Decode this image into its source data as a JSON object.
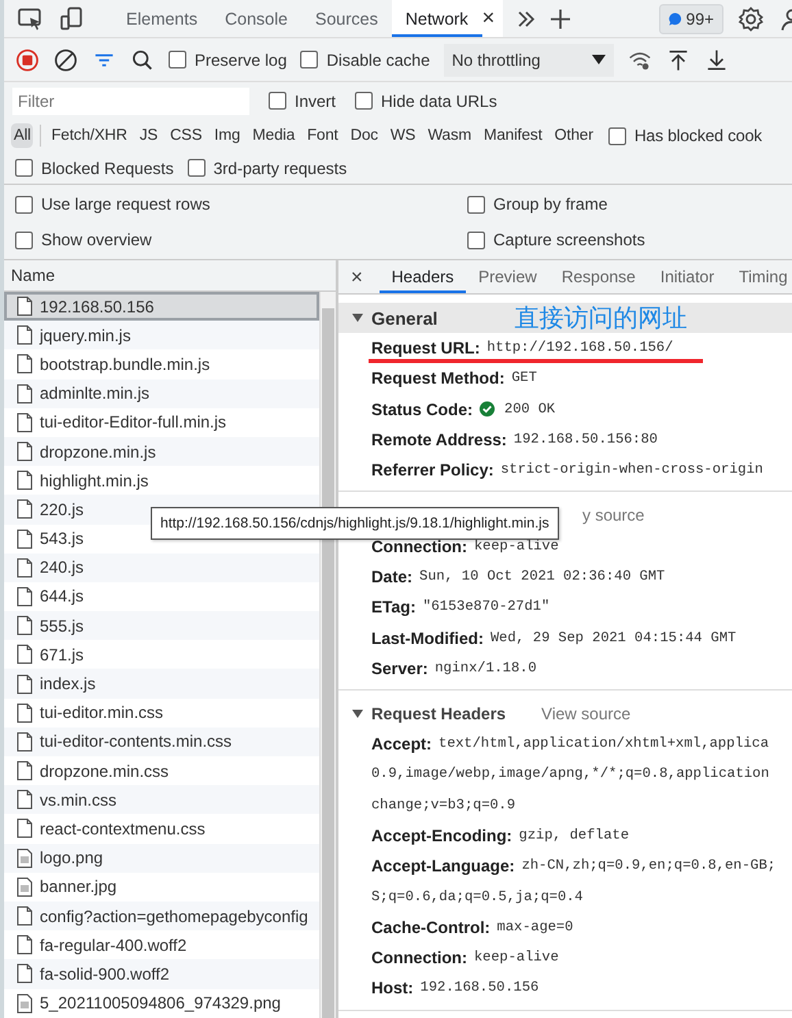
{
  "main_tabs": [
    {
      "label": "Elements",
      "selected": false
    },
    {
      "label": "Console",
      "selected": false
    },
    {
      "label": "Sources",
      "selected": false
    },
    {
      "label": "Network",
      "selected": true
    }
  ],
  "close_tab_glyph": "×",
  "issues_badge": "99+",
  "toolbar": {
    "recording": true,
    "filter_active": true,
    "checkboxes": [
      {
        "label": "Preserve log",
        "checked": false
      },
      {
        "label": "Disable cache",
        "checked": false
      }
    ],
    "throttling": "No throttling"
  },
  "filter": {
    "placeholder": "Filter",
    "checkboxes": [
      {
        "label": "Invert",
        "checked": false
      },
      {
        "label": "Hide data URLs",
        "checked": false
      }
    ]
  },
  "type_filters": [
    {
      "label": "All",
      "selected": true
    },
    {
      "label": "Fetch/XHR",
      "selected": false
    },
    {
      "label": "JS",
      "selected": false
    },
    {
      "label": "CSS",
      "selected": false
    },
    {
      "label": "Img",
      "selected": false
    },
    {
      "label": "Media",
      "selected": false
    },
    {
      "label": "Font",
      "selected": false
    },
    {
      "label": "Doc",
      "selected": false
    },
    {
      "label": "WS",
      "selected": false
    },
    {
      "label": "Wasm",
      "selected": false
    },
    {
      "label": "Manifest",
      "selected": false
    },
    {
      "label": "Other",
      "selected": false
    }
  ],
  "type_checkbox": {
    "label": "Has blocked cook",
    "checked": false
  },
  "request_checkboxes": [
    {
      "label": "Blocked Requests",
      "checked": false
    },
    {
      "label": "3rd-party requests",
      "checked": false
    }
  ],
  "settings": [
    {
      "label": "Use large request rows",
      "checked": false
    },
    {
      "label": "Group by frame",
      "checked": false
    },
    {
      "label": "Show overview",
      "checked": false
    },
    {
      "label": "Capture screenshots",
      "checked": false
    }
  ],
  "requests": {
    "column": "Name",
    "rows": [
      {
        "name": "192.168.50.156",
        "kind": "doc",
        "selected": true
      },
      {
        "name": "jquery.min.js",
        "kind": "doc",
        "selected": false
      },
      {
        "name": "bootstrap.bundle.min.js",
        "kind": "doc",
        "selected": false
      },
      {
        "name": "adminlte.min.js",
        "kind": "doc",
        "selected": false
      },
      {
        "name": "tui-editor-Editor-full.min.js",
        "kind": "doc",
        "selected": false
      },
      {
        "name": "dropzone.min.js",
        "kind": "doc",
        "selected": false
      },
      {
        "name": "highlight.min.js",
        "kind": "doc",
        "selected": false
      },
      {
        "name": "220.js",
        "kind": "doc",
        "selected": false
      },
      {
        "name": "543.js",
        "kind": "doc",
        "selected": false
      },
      {
        "name": "240.js",
        "kind": "doc",
        "selected": false
      },
      {
        "name": "644.js",
        "kind": "doc",
        "selected": false
      },
      {
        "name": "555.js",
        "kind": "doc",
        "selected": false
      },
      {
        "name": "671.js",
        "kind": "doc",
        "selected": false
      },
      {
        "name": "index.js",
        "kind": "doc",
        "selected": false
      },
      {
        "name": "tui-editor.min.css",
        "kind": "doc",
        "selected": false
      },
      {
        "name": "tui-editor-contents.min.css",
        "kind": "doc",
        "selected": false
      },
      {
        "name": "dropzone.min.css",
        "kind": "doc",
        "selected": false
      },
      {
        "name": "vs.min.css",
        "kind": "doc",
        "selected": false
      },
      {
        "name": "react-contextmenu.css",
        "kind": "doc",
        "selected": false
      },
      {
        "name": "logo.png",
        "kind": "image",
        "selected": false
      },
      {
        "name": "banner.jpg",
        "kind": "image",
        "selected": false
      },
      {
        "name": "config?action=gethomepagebyconfig",
        "kind": "doc",
        "selected": false
      },
      {
        "name": "fa-regular-400.woff2",
        "kind": "doc",
        "selected": false
      },
      {
        "name": "fa-solid-900.woff2",
        "kind": "doc",
        "selected": false
      },
      {
        "name": "5_20211005094806_974329.png",
        "kind": "image",
        "selected": false
      }
    ]
  },
  "tooltip": "http://192.168.50.156/cdnjs/highlight.js/9.18.1/highlight.min.js",
  "detail_close_glyph": "×",
  "detail_tabs": [
    {
      "label": "Headers",
      "selected": true
    },
    {
      "label": "Preview",
      "selected": false
    },
    {
      "label": "Response",
      "selected": false
    },
    {
      "label": "Initiator",
      "selected": false
    },
    {
      "label": "Timing",
      "selected": false
    }
  ],
  "annotation": "直接访问的网址",
  "sections": [
    {
      "title": "General",
      "kind": "general",
      "expanded": true,
      "rows": [
        {
          "name": "Request URL:",
          "value": "http://192.168.50.156/",
          "kind": "underlined"
        },
        {
          "name": "Request Method:",
          "value": "GET",
          "kind": "plain"
        },
        {
          "name": "Status Code:",
          "value": "200 OK",
          "kind": "status"
        },
        {
          "name": "Remote Address:",
          "value": "192.168.50.156:80",
          "kind": "plain"
        },
        {
          "name": "Referrer Policy:",
          "value": "strict-origin-when-cross-origin",
          "kind": "plain"
        }
      ]
    },
    {
      "link": "y source",
      "kind": "covered",
      "rows": [
        {
          "name": "Connection:",
          "value": "keep-alive",
          "kind": "plain"
        },
        {
          "name": "Date:",
          "value": "Sun, 10 Oct 2021 02:36:40 GMT",
          "kind": "plain"
        },
        {
          "name": "ETag:",
          "value": "\"6153e870-27d1\"",
          "kind": "plain"
        },
        {
          "name": "Last-Modified:",
          "value": "Wed, 29 Sep 2021 04:15:44 GMT",
          "kind": "plain"
        },
        {
          "name": "Server:",
          "value": "nginx/1.18.0",
          "kind": "plain"
        }
      ]
    },
    {
      "title": "Request Headers",
      "link": "View source",
      "kind": "request",
      "expanded": true,
      "rows": [
        {
          "name": "Accept:",
          "value": "text/html,application/xhtml+xml,applica",
          "kind": "plain"
        },
        {
          "value": "0.9,image/webp,image/apng,*/*;q=0.8,application",
          "kind": "continuation"
        },
        {
          "value": "change;v=b3;q=0.9",
          "kind": "continuation"
        },
        {
          "name": "Accept-Encoding:",
          "value": "gzip, deflate",
          "kind": "plain"
        },
        {
          "name": "Accept-Language:",
          "value": "zh-CN,zh;q=0.9,en;q=0.8,en-GB;",
          "kind": "plain"
        },
        {
          "value": "S;q=0.6,da;q=0.5,ja;q=0.4",
          "kind": "continuation"
        },
        {
          "name": "Cache-Control:",
          "value": "max-age=0",
          "kind": "plain"
        },
        {
          "name": "Connection:",
          "value": "keep-alive",
          "kind": "plain"
        },
        {
          "name": "Host:",
          "value": "192.168.50.156",
          "kind": "plain"
        }
      ]
    }
  ]
}
